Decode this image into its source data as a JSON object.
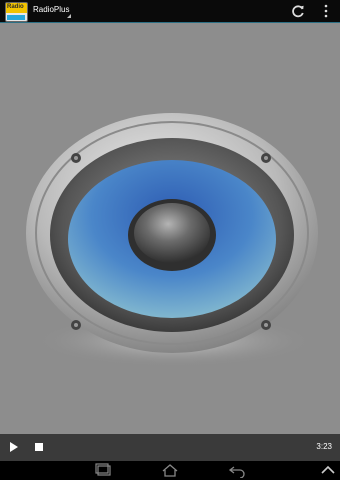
{
  "app": {
    "title": "RadioPlus",
    "logo_text": "Radio"
  },
  "actionbar": {
    "refresh_icon": "refresh-icon",
    "overflow_icon": "overflow-menu-icon"
  },
  "player": {
    "play_icon": "play-icon",
    "stop_icon": "stop-icon",
    "time": "3:23"
  },
  "colors": {
    "actionbar_bg": "#0a0a0a",
    "content_bg": "#8d8d8d",
    "player_bg": "#3a3a3a",
    "speaker_cone": "#4a86c9"
  },
  "navbar": {
    "icons": [
      "recent-apps-icon",
      "home-icon",
      "back-icon",
      "collapse-icon"
    ]
  }
}
